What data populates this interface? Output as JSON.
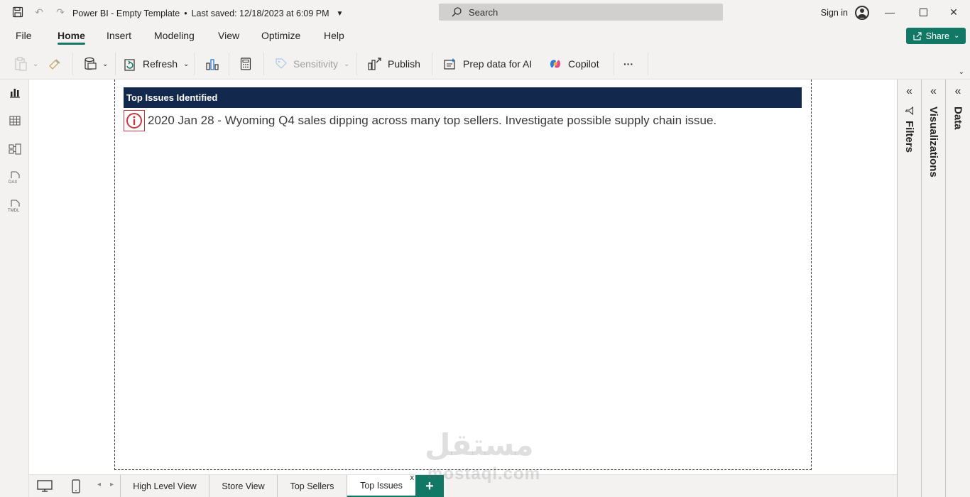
{
  "titlebar": {
    "title": "Power BI - Empty Template",
    "saved": "Last saved: 12/18/2023 at 6:09 PM",
    "search_placeholder": "Search",
    "signin": "Sign in"
  },
  "menu": {
    "items": [
      "File",
      "Home",
      "Insert",
      "Modeling",
      "View",
      "Optimize",
      "Help"
    ],
    "active": "Home",
    "share_label": "Share"
  },
  "ribbon": {
    "refresh": "Refresh",
    "sensitivity": "Sensitivity",
    "publish": "Publish",
    "prep_data": "Prep data for AI",
    "copilot": "Copilot",
    "more": "···"
  },
  "report": {
    "visual_title": "Top Issues Identified",
    "issue_text": "2020 Jan 28 - Wyoming Q4 sales dipping across many top sellers. Investigate possible supply chain issue."
  },
  "panes": {
    "filters": "Filters",
    "visualizations": "Visualizations",
    "data": "Data"
  },
  "tabs": {
    "items": [
      "High Level View",
      "Store View",
      "Top Sellers",
      "Top Issues"
    ],
    "active": "Top Issues",
    "close": "x",
    "add": "+"
  },
  "watermark": {
    "arabic": "مستقل",
    "latin": "mostaql.com"
  },
  "colors": {
    "accent": "#117865",
    "header_bg": "#12284c",
    "issue_red": "#c8383f"
  }
}
